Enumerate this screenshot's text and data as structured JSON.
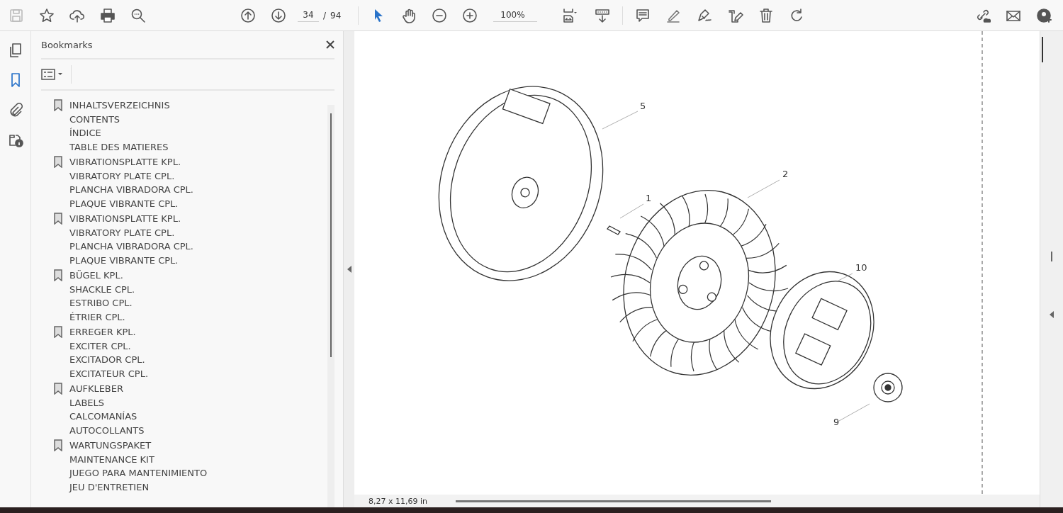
{
  "toolbar": {
    "page_number": "34",
    "page_separator": "/",
    "page_count": "94",
    "zoom": "100%"
  },
  "side_rail": [
    {
      "kind": "pages",
      "selected": false
    },
    {
      "kind": "bookmarks",
      "selected": true
    },
    {
      "kind": "attachments",
      "selected": false
    },
    {
      "kind": "info",
      "selected": false
    }
  ],
  "bookmarks_panel": {
    "title": "Bookmarks",
    "items": [
      {
        "lines": [
          "INHALTSVERZEICHNIS",
          "CONTENTS",
          "ÍNDICE",
          "TABLE DES MATIERES"
        ]
      },
      {
        "lines": [
          "VIBRATIONSPLATTE KPL.",
          "VIBRATORY PLATE CPL.",
          "PLANCHA VIBRADORA CPL.",
          "PLAQUE VIBRANTE CPL."
        ]
      },
      {
        "lines": [
          "VIBRATIONSPLATTE KPL.",
          "VIBRATORY PLATE CPL.",
          "PLANCHA VIBRADORA CPL.",
          "PLAQUE VIBRANTE CPL."
        ]
      },
      {
        "lines": [
          "BÜGEL KPL.",
          "SHACKLE CPL.",
          "ESTRIBO CPL.",
          "ÉTRIER CPL."
        ]
      },
      {
        "lines": [
          "ERREGER KPL.",
          "EXCITER CPL.",
          "EXCITADOR CPL.",
          "EXCITATEUR CPL."
        ]
      },
      {
        "lines": [
          "AUFKLEBER",
          "LABELS",
          "CALCOMANÍAS",
          "AUTOCOLLANTS"
        ]
      },
      {
        "lines": [
          "WARTUNGSPAKET",
          "MAINTENANCE KIT",
          "JUEGO PARA MANTENIMIENTO",
          "JEU D'ENTRETIEN"
        ]
      }
    ]
  },
  "drawing": {
    "callouts": [
      "5",
      "2",
      "1",
      "10",
      "9"
    ]
  },
  "status_bar": {
    "page_size": "8,27 x 11,69 in"
  }
}
